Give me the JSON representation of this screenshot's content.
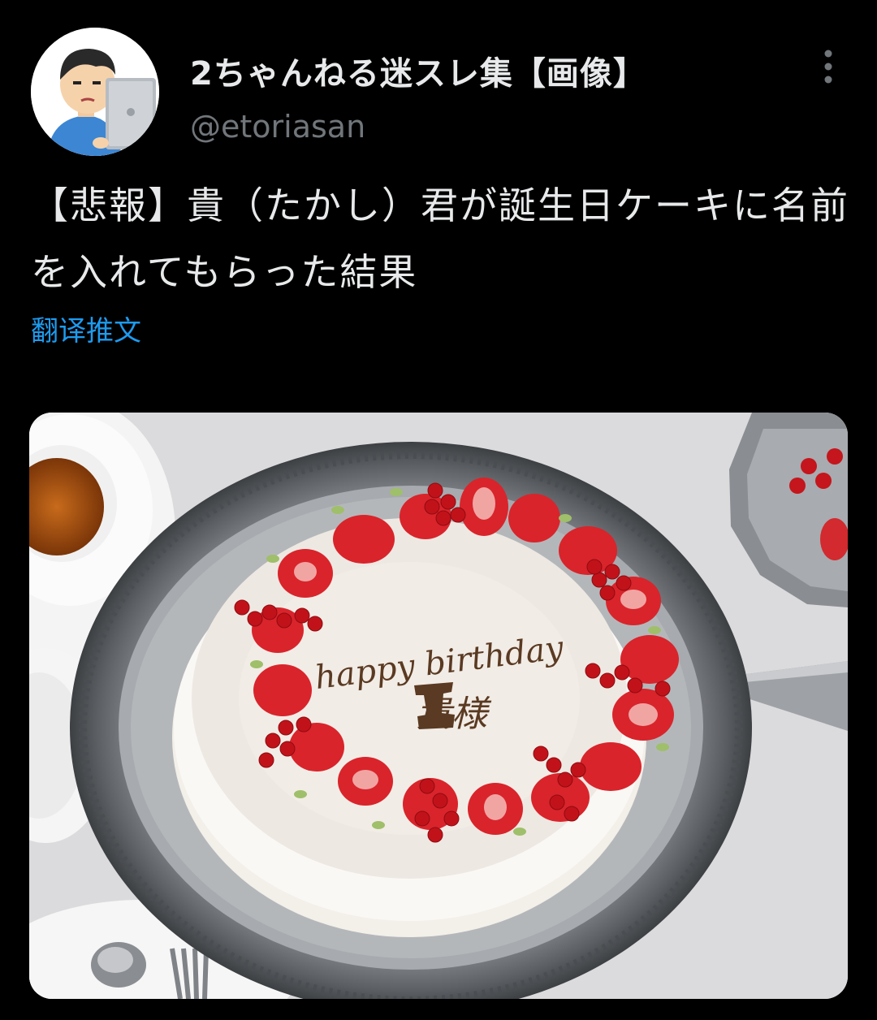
{
  "author": {
    "display_name": "2ちゃんねる迷スレ集【画像】",
    "handle": "@etoriasan",
    "avatar_icon": "person-at-laptop-avatar"
  },
  "tweet": {
    "text": "【悲報】貴（たかし）君が誕生日ケーキに名前を入れてもらった結果",
    "translate_label": "翻译推文"
  },
  "media": {
    "icon": "birthday-cake-photo",
    "cake_line1": "happy birthday",
    "cake_line2": "貴様"
  },
  "colors": {
    "background": "#000000",
    "primary_text": "#e7e9ea",
    "secondary_text": "#71767b",
    "link": "#1d9bf0"
  }
}
